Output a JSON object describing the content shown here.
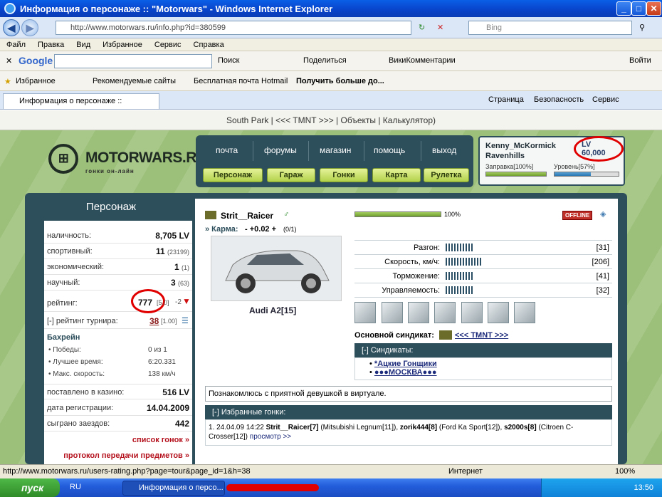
{
  "window": {
    "title": "Информация о персонаже :: \"Motorwars\" - Windows Internet Explorer",
    "min": "_",
    "max": "□",
    "close": "✕"
  },
  "address": {
    "url": "http://www.motorwars.ru/info.php?id=380599",
    "search_placeholder": "Bing"
  },
  "menu": [
    "Файл",
    "Правка",
    "Вид",
    "Избранное",
    "Сервис",
    "Справка"
  ],
  "googlebar": {
    "logo": "Google",
    "search": "Поиск",
    "share": "Поделиться",
    "wiki": "ВикиКомментарии",
    "login": "Войти"
  },
  "favbar": {
    "favorites": "Избранное",
    "rec": "Рекомендуемые сайты",
    "hotmail": "Бесплатная почта Hotmail",
    "more": "Получить больше до..."
  },
  "tabrow": {
    "tab": "Информация о персонаже :: \"Motorwars\"",
    "page": "Страница",
    "security": "Безопасность",
    "service": "Сервис"
  },
  "site": {
    "toplinks": "South Park | <<< TMNT >>> | Объекты | Калькулятор)",
    "logo_text": "MOTORWARS.RU",
    "logo_sub": "гонки он-лайн",
    "nav_top": [
      "почта",
      "форумы",
      "магазин",
      "помощь",
      "выход"
    ],
    "nav_btns": [
      "Персонаж",
      "Гараж",
      "Гонки",
      "Карта",
      "Рулетка"
    ],
    "user": {
      "name": "Kenny_McKormick",
      "city": "Ravenhills",
      "lv": "LV 60,000",
      "fuel_label": "Заправка[100%]",
      "fuel": 100,
      "level_label": "Уровень[57%]",
      "level": 57
    },
    "left": {
      "title": "Персонаж",
      "rows": [
        {
          "l": "наличность:",
          "v": "8,705 LV",
          "s": ""
        },
        {
          "l": "спортивный:",
          "v": "11",
          "s": "(23199)"
        },
        {
          "l": "экономический:",
          "v": "1",
          "s": "(1)"
        },
        {
          "l": "научный:",
          "v": "3",
          "s": "(63)"
        }
      ],
      "rating_l": "рейтинг:",
      "rating_v": "777",
      "rating_s": "[5.0]",
      "rating_d": "-2",
      "tour_l": "[-] рейтинг турнира:",
      "tour_v": "38",
      "tour_s": "[1.00]",
      "bah": "Бахрейн",
      "bah_rows": [
        {
          "l": "Победы:",
          "v": "0 из 1"
        },
        {
          "l": "Лучшее время:",
          "v": "6:20.331"
        },
        {
          "l": "Макс. скорость:",
          "v": "138 км/ч"
        }
      ],
      "rows2": [
        {
          "l": "поставлено в казино:",
          "v": "516 LV"
        },
        {
          "l": "дата регистрации:",
          "v": "14.04.2009"
        },
        {
          "l": "сыграно заездов:",
          "v": "442"
        }
      ],
      "list_races": "список гонок »",
      "protocol": "протокол передачи предметов »"
    },
    "main": {
      "player": "Strit__Raicer",
      "karma_label": "» Карма:",
      "karma_value": "- +0.02 +",
      "karma_ratio": "(0/1)",
      "car": "Audi A2[15]",
      "progress": 100,
      "progress_label": "100%",
      "offline": "OFFLINE",
      "stats": [
        {
          "n": "Разгон:",
          "v": "[31]",
          "w": 31
        },
        {
          "n": "Скорость, км/ч:",
          "v": "[206]",
          "w": 206
        },
        {
          "n": "Торможение:",
          "v": "[41]",
          "w": 41
        },
        {
          "n": "Управляемость:",
          "v": "[32]",
          "w": 32
        }
      ],
      "syndicate_label": "Основной синдикат:",
      "syndicate": "<<< TMNT >>>",
      "synd_head": "[-]   Синдикаты:",
      "synd_list": [
        "*Ацкие Гонщики",
        "●●●МОСКВА●●●"
      ],
      "about": "Познакомлюсь с приятной девушкой в виртуале.",
      "fav_head": "[-]   Избранные гонки:",
      "race": {
        "num": "1.",
        "date": "24.04.09 14:22",
        "p1": "Strit__Raicer[7]",
        "c1": "(Mitsubishi Legnum[11]),",
        "p2": "zorik444[8]",
        "c2": "(Ford Ka Sport[12]),",
        "p3": "s2000s[8]",
        "c3": "(Citroen C-Crosser[12])",
        "view": "просмотр >>"
      }
    }
  },
  "status": {
    "url": "http://www.motorwars.ru/users-rating.php?page=tour&page_id=1&h=38",
    "zone": "Интернет",
    "zoom": "100%"
  },
  "taskbar": {
    "start": "пуск",
    "lang": "RU",
    "task": "Информация о персо...",
    "time": "13:50"
  }
}
